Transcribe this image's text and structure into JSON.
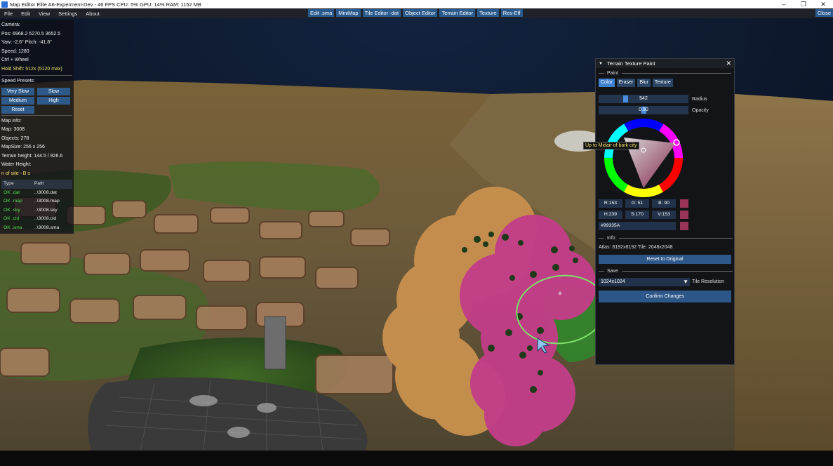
{
  "window": {
    "title": "Map Editor Elite A6-Experment-Dev - 46 FPS  CPU: 5%  GPU: 14%  RAM: 1152 MB",
    "controls": [
      "–",
      "❐",
      "✕"
    ]
  },
  "menu": {
    "items": [
      "File",
      "Edit",
      "View",
      "Settings",
      "About"
    ],
    "tools": [
      "Edit .sma",
      "MiniMap",
      "Tile Editor -dat",
      "Object Editor",
      "Terrain Editor",
      "Texture",
      "Res-Eff"
    ],
    "close_label": "Close"
  },
  "camera": {
    "heading": "Camera:",
    "pos": "Pos: 6968.2 5270.5 3652.5",
    "yaw_pitch": "Yaw: -2.6°  Pitch: -41.8°",
    "speed": "Speed: 1280",
    "ctrl_wheel": "Ctrl + Wheel",
    "hold_shift": "Hold Shift: 512x (5120 max)"
  },
  "speed_presets": {
    "heading": "Speed Presets:",
    "very_slow": "Very Slow",
    "slow": "Slow",
    "medium": "Medium",
    "high": "High",
    "reset": "Reset"
  },
  "map_info": {
    "heading": "Map info:",
    "map": "Map: 3008",
    "objects": "Objects: 278",
    "map_size": "MapSize: 256 x 256",
    "terrain_height": "Terrain height: 144.5 / 926.6",
    "water_height": "Water Height:",
    "site": "n of site - B s"
  },
  "files": {
    "headers": [
      "Type",
      "Path"
    ],
    "rows": [
      {
        "type": "OK .dat",
        "path": "..\\3008.dat"
      },
      {
        "type": "OK .map",
        "path": "..\\3008.map"
      },
      {
        "type": "OK .sky",
        "path": "..\\3008.sky"
      },
      {
        "type": "OK .cld",
        "path": "..\\3008.cld"
      },
      {
        "type": "OK .sma",
        "path": "..\\3008.sma"
      }
    ]
  },
  "paint_panel": {
    "title": "Terrain Texture Paint",
    "paint_section": "Paint",
    "modes": [
      "Color",
      "Eraser",
      "Blur",
      "Texture"
    ],
    "active_mode": "Color",
    "radius_value": "542",
    "radius_level": 0.29,
    "radius_label": "Radius",
    "opacity_value": "0.50",
    "opacity_level": 0.5,
    "opacity_label": "Opacity",
    "tooltip": "Up to Midair of bark city",
    "rgb": {
      "r": "R:153",
      "g": "G: 51",
      "b": "B: 90"
    },
    "hsv": {
      "h": "H:239",
      "s": "S:170",
      "v": "V:153"
    },
    "hex": "#99335A",
    "swatch_color": "#99335A",
    "info_section": "Info",
    "atlas": "Atlas: 8192x8192  Tile: 2048x2048",
    "reset_button": "Reset to Original",
    "save_section": "Save",
    "resolution_value": "1024x1024",
    "resolution_label": "Tile Resolution",
    "confirm_button": "Confirm Changes"
  }
}
